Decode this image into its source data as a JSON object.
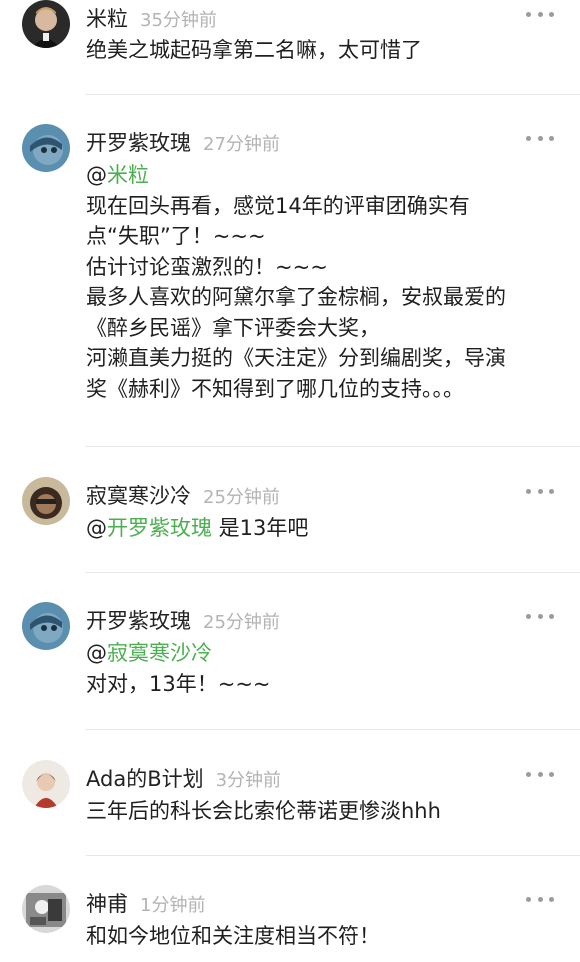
{
  "comments": [
    {
      "username": "米粒",
      "time": "35分钟前",
      "lines": [
        "绝美之城起码拿第二名嘛，太可惜了"
      ]
    },
    {
      "username": "开罗紫玫瑰",
      "time": "27分钟前",
      "mention": "米粒",
      "lines": [
        "现在回头再看，感觉14年的评审团确实有",
        "点“失职”了！~~~",
        "估计讨论蛮激烈的！~~~",
        "最多人喜欢的阿黛尔拿了金棕榈，安叔最爱的",
        "《醉乡民谣》拿下评委会大奖，",
        "河濑直美力挺的《天注定》分到编剧奖，导演",
        "奖《赫利》不知得到了哪几位的支持。。。"
      ]
    },
    {
      "username": "寂寞寒沙冷",
      "time": "25分钟前",
      "mention": "开罗紫玫瑰",
      "mention_suffix": " 是13年吧",
      "lines": []
    },
    {
      "username": "开罗紫玫瑰",
      "time": "25分钟前",
      "mention": "寂寞寒沙冷",
      "lines": [
        "对对，13年！~~~"
      ]
    },
    {
      "username": "Ada的B计划",
      "time": "3分钟前",
      "lines": [
        "三年后的科长会比索伦蒂诺更惨淡hhh"
      ]
    },
    {
      "username": "神甫",
      "time": "1分钟前",
      "lines": [
        "和如今地位和关注度相当不符！"
      ]
    }
  ]
}
